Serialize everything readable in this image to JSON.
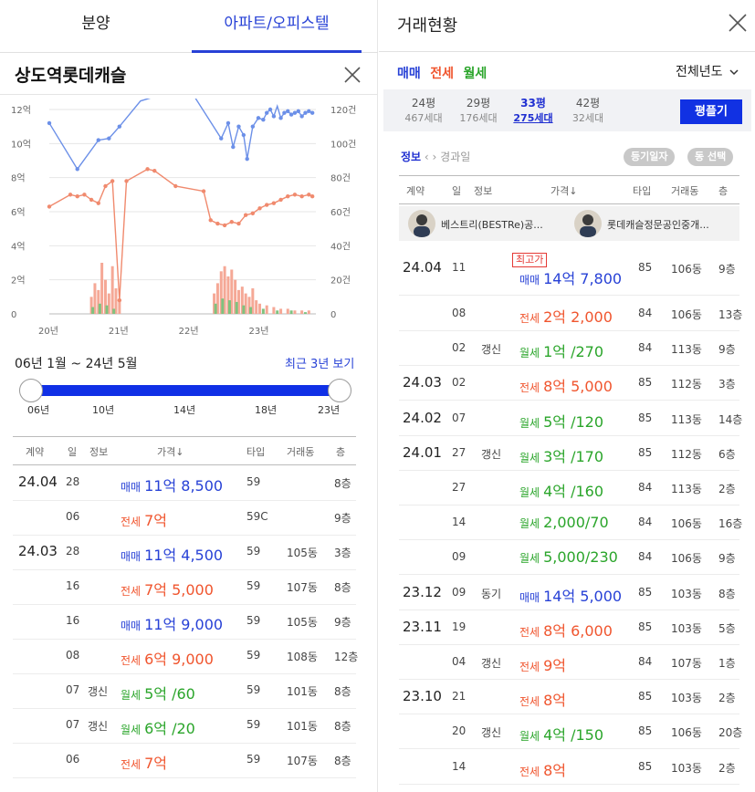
{
  "tabs": [
    {
      "label": "분양"
    },
    {
      "label": "아파트/오피스텔"
    }
  ],
  "complex": {
    "name": "상도역롯데캐슬"
  },
  "chart_data": {
    "type": "line",
    "x_ticks": [
      "20년",
      "21년",
      "22년",
      "23년"
    ],
    "y_left_ticks": [
      "12억",
      "10억",
      "8억",
      "6억",
      "4억",
      "2억",
      "0"
    ],
    "y_right_ticks": [
      "120건",
      "100건",
      "80건",
      "60건",
      "40건",
      "20건",
      "0"
    ],
    "ylim_left": [
      0,
      12
    ],
    "ylim_right": [
      0,
      120
    ],
    "xlim": [
      2020,
      2023.8
    ],
    "series": [
      {
        "type": "line",
        "color": "#6c90e8",
        "x": [
          2020.0,
          2020.4,
          2020.7,
          2020.85,
          2021.0,
          2021.3,
          2021.7,
          2022.0,
          2022.45,
          2022.55,
          2022.62,
          2022.7,
          2022.77,
          2022.82,
          2022.9,
          2022.98,
          2023.05,
          2023.1,
          2023.15,
          2023.2,
          2023.25,
          2023.3,
          2023.35,
          2023.4,
          2023.45,
          2023.5,
          2023.55,
          2023.6,
          2023.65,
          2023.7,
          2023.75
        ],
        "y": [
          11.2,
          8.5,
          10.2,
          10.3,
          11.0,
          12.5,
          13.0,
          13.2,
          10.3,
          11.2,
          9.8,
          11.0,
          10.5,
          9.1,
          11.0,
          11.5,
          11.4,
          11.8,
          12.0,
          11.6,
          12.2,
          11.5,
          11.8,
          11.9,
          11.7,
          11.8,
          11.9,
          11.6,
          11.8,
          11.9,
          11.8
        ]
      },
      {
        "type": "line",
        "color": "#f08a6e",
        "x": [
          2020.0,
          2020.3,
          2020.4,
          2020.5,
          2020.6,
          2020.7,
          2020.8,
          2020.9,
          2021.0,
          2021.1,
          2021.4,
          2021.5,
          2021.8,
          2022.2,
          2022.3,
          2022.4,
          2022.5,
          2022.6,
          2022.7,
          2022.8,
          2022.9,
          2023.0,
          2023.1,
          2023.2,
          2023.3,
          2023.4,
          2023.5,
          2023.6,
          2023.7,
          2023.75
        ],
        "y": [
          6.3,
          7.0,
          6.9,
          7.0,
          6.7,
          6.5,
          7.5,
          7.8,
          0.8,
          7.8,
          8.5,
          8.4,
          7.5,
          7.2,
          5.5,
          5.3,
          5.2,
          5.4,
          5.3,
          5.8,
          5.9,
          6.2,
          6.4,
          6.5,
          6.7,
          6.9,
          7.0,
          6.9,
          7.0,
          6.9
        ]
      },
      {
        "type": "bar",
        "color": "#f5a896",
        "axis": "right",
        "x": [
          2020.6,
          2020.65,
          2020.7,
          2020.75,
          2020.8,
          2020.85,
          2020.9,
          2020.95,
          2021.0,
          2022.35,
          2022.4,
          2022.45,
          2022.5,
          2022.55,
          2022.6,
          2022.65,
          2022.7,
          2022.75,
          2022.8,
          2022.85,
          2022.9,
          2022.95,
          2023.0,
          2023.1,
          2023.2,
          2023.3,
          2023.4,
          2023.5,
          2023.6,
          2023.7
        ],
        "values": [
          10,
          18,
          14,
          30,
          20,
          12,
          28,
          15,
          8,
          12,
          18,
          25,
          28,
          22,
          26,
          20,
          14,
          16,
          12,
          10,
          15,
          8,
          6,
          5,
          4,
          3,
          3,
          2,
          2,
          2
        ]
      },
      {
        "type": "bar",
        "color": "#7fc27f",
        "axis": "right",
        "x": [
          2020.62,
          2020.72,
          2020.82,
          2020.92,
          2022.37,
          2022.47,
          2022.57,
          2022.67,
          2022.77,
          2022.87,
          2023.05,
          2023.25,
          2023.45,
          2023.65
        ],
        "values": [
          4,
          6,
          5,
          3,
          6,
          9,
          8,
          7,
          5,
          4,
          3,
          2,
          2,
          1
        ]
      }
    ]
  },
  "period": {
    "label": "06년 1월 ~ 24년 5월",
    "recent_label": "최근 3년 보기"
  },
  "slider": {
    "ticks": [
      "06년",
      "10년",
      "14년",
      "18년",
      "23년"
    ]
  },
  "left_table": {
    "headers": [
      "계약",
      "일",
      "정보",
      "가격↓",
      "타입",
      "거래동",
      "층"
    ],
    "rows": [
      {
        "ym": "24.04",
        "day": "28",
        "info": "",
        "kind": "매매",
        "price": "11억 8,500",
        "type": "59",
        "dong": "",
        "floor": "8층",
        "color": "blue"
      },
      {
        "ym": "",
        "day": "06",
        "info": "",
        "kind": "전세",
        "price": "7억",
        "type": "59C",
        "dong": "",
        "floor": "9층",
        "color": "red"
      },
      {
        "ym": "24.03",
        "day": "28",
        "info": "",
        "kind": "매매",
        "price": "11억 4,500",
        "type": "59",
        "dong": "105동",
        "floor": "3층",
        "color": "blue"
      },
      {
        "ym": "",
        "day": "16",
        "info": "",
        "kind": "전세",
        "price": "7억 5,000",
        "type": "59",
        "dong": "107동",
        "floor": "8층",
        "color": "red"
      },
      {
        "ym": "",
        "day": "16",
        "info": "",
        "kind": "매매",
        "price": "11억 9,000",
        "type": "59",
        "dong": "105동",
        "floor": "9층",
        "color": "blue"
      },
      {
        "ym": "",
        "day": "08",
        "info": "",
        "kind": "전세",
        "price": "6억 9,000",
        "type": "59",
        "dong": "108동",
        "floor": "12층",
        "color": "red"
      },
      {
        "ym": "",
        "day": "07",
        "info": "갱신",
        "kind": "월세",
        "price": "5억 /60",
        "type": "59",
        "dong": "101동",
        "floor": "8층",
        "color": "green"
      },
      {
        "ym": "",
        "day": "07",
        "info": "갱신",
        "kind": "월세",
        "price": "6억 /20",
        "type": "59",
        "dong": "101동",
        "floor": "8층",
        "color": "green"
      },
      {
        "ym": "",
        "day": "06",
        "info": "",
        "kind": "전세",
        "price": "7억",
        "type": "59",
        "dong": "107동",
        "floor": "8층",
        "color": "red"
      }
    ]
  },
  "right": {
    "title": "거래현황",
    "deal_types": [
      {
        "label": "매매",
        "color": "blue"
      },
      {
        "label": "전세",
        "color": "red"
      },
      {
        "label": "월세",
        "color": "green"
      }
    ],
    "year_filter": "전체년도",
    "sizes": [
      {
        "area": "24평",
        "count": "467세대",
        "selected": false
      },
      {
        "area": "29평",
        "count": "176세대",
        "selected": false
      },
      {
        "area": "33평",
        "count": "275세대",
        "selected": true
      },
      {
        "area": "42평",
        "count": "32세대",
        "selected": false
      }
    ],
    "calc_button": "평플기",
    "info_label": "정보",
    "elapsed_label": "경과일",
    "pill_registry": "등기일자",
    "pill_dong": "동 선택",
    "headers": [
      "계약",
      "일",
      "정보",
      "가격↓",
      "타입",
      "거래동",
      "층"
    ],
    "agents": [
      {
        "name": "베스트리(BESTRe)공..."
      },
      {
        "name": "롯데캐슬정문공인중개..."
      }
    ],
    "max_badge": "최고가",
    "rows": [
      {
        "ym": "24.04",
        "day": "11",
        "info": "",
        "kind": "매매",
        "price": "14억 7,800",
        "type": "85",
        "dong": "106동",
        "floor": "9층",
        "color": "blue"
      },
      {
        "ym": "",
        "day": "08",
        "info": "",
        "kind": "전세",
        "price": "2억 2,000",
        "type": "84",
        "dong": "106동",
        "floor": "13층",
        "color": "red"
      },
      {
        "ym": "",
        "day": "02",
        "info": "갱신",
        "kind": "월세",
        "price": "1억 /270",
        "type": "84",
        "dong": "113동",
        "floor": "9층",
        "color": "green"
      },
      {
        "ym": "24.03",
        "day": "02",
        "info": "",
        "kind": "전세",
        "price": "8억 5,000",
        "type": "85",
        "dong": "112동",
        "floor": "3층",
        "color": "red"
      },
      {
        "ym": "24.02",
        "day": "07",
        "info": "",
        "kind": "월세",
        "price": "5억 /120",
        "type": "85",
        "dong": "113동",
        "floor": "14층",
        "color": "green"
      },
      {
        "ym": "24.01",
        "day": "27",
        "info": "갱신",
        "kind": "월세",
        "price": "3억 /170",
        "type": "85",
        "dong": "112동",
        "floor": "6층",
        "color": "green"
      },
      {
        "ym": "",
        "day": "27",
        "info": "",
        "kind": "월세",
        "price": "4억 /160",
        "type": "84",
        "dong": "113동",
        "floor": "2층",
        "color": "green"
      },
      {
        "ym": "",
        "day": "14",
        "info": "",
        "kind": "월세",
        "price": "2,000/70",
        "type": "84",
        "dong": "106동",
        "floor": "16층",
        "color": "green"
      },
      {
        "ym": "",
        "day": "09",
        "info": "",
        "kind": "월세",
        "price": "5,000/230",
        "type": "84",
        "dong": "106동",
        "floor": "9층",
        "color": "green"
      },
      {
        "ym": "23.12",
        "day": "09",
        "info": "동기",
        "kind": "매매",
        "price": "14억 5,000",
        "type": "85",
        "dong": "103동",
        "floor": "8층",
        "color": "blue"
      },
      {
        "ym": "23.11",
        "day": "19",
        "info": "",
        "kind": "전세",
        "price": "8억 6,000",
        "type": "85",
        "dong": "103동",
        "floor": "5층",
        "color": "red"
      },
      {
        "ym": "",
        "day": "04",
        "info": "갱신",
        "kind": "전세",
        "price": "9억",
        "type": "84",
        "dong": "107동",
        "floor": "1층",
        "color": "red"
      },
      {
        "ym": "23.10",
        "day": "21",
        "info": "",
        "kind": "전세",
        "price": "8억",
        "type": "85",
        "dong": "103동",
        "floor": "2층",
        "color": "red"
      },
      {
        "ym": "",
        "day": "20",
        "info": "갱신",
        "kind": "월세",
        "price": "4억 /150",
        "type": "85",
        "dong": "106동",
        "floor": "20층",
        "color": "green"
      },
      {
        "ym": "",
        "day": "14",
        "info": "",
        "kind": "전세",
        "price": "8억",
        "type": "85",
        "dong": "103동",
        "floor": "2층",
        "color": "red"
      }
    ]
  }
}
